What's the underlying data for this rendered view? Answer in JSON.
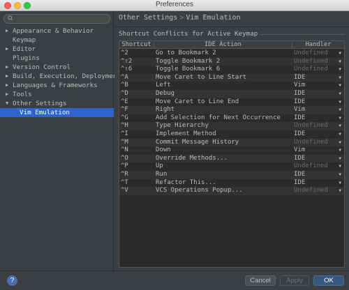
{
  "window": {
    "title": "Preferences"
  },
  "search": {
    "placeholder": ""
  },
  "sidebar": {
    "items": [
      {
        "label": "Appearance & Behavior",
        "arrow": "▶",
        "expanded": false
      },
      {
        "label": "Keymap",
        "arrow": ""
      },
      {
        "label": "Editor",
        "arrow": "▶"
      },
      {
        "label": "Plugins",
        "arrow": ""
      },
      {
        "label": "Version Control",
        "arrow": "▶"
      },
      {
        "label": "Build, Execution, Deployment",
        "arrow": "▶"
      },
      {
        "label": "Languages & Frameworks",
        "arrow": "▶"
      },
      {
        "label": "Tools",
        "arrow": "▶"
      },
      {
        "label": "Other Settings",
        "arrow": "▼"
      },
      {
        "label": "Vim Emulation",
        "arrow": "",
        "child": true,
        "selected": true
      }
    ]
  },
  "breadcrumb": {
    "parent": "Other Settings",
    "separator": ">",
    "current": "Vim Emulation"
  },
  "section": {
    "title": "Shortcut Conflicts for Active Keymap"
  },
  "table": {
    "headers": {
      "shortcut": "Shortcut",
      "action": "IDE Action",
      "handler": "Handler"
    },
    "rows": [
      {
        "shortcut": "^2",
        "action": "Go to Bookmark 2",
        "handler": "Undefined"
      },
      {
        "shortcut": "^⇧2",
        "action": "Toggle Bookmark 2",
        "handler": "Undefined"
      },
      {
        "shortcut": "^⇧6",
        "action": "Toggle Bookmark 6",
        "handler": "Undefined"
      },
      {
        "shortcut": "^A",
        "action": "Move Caret to Line Start",
        "handler": "IDE"
      },
      {
        "shortcut": "^B",
        "action": "Left",
        "handler": "Vim"
      },
      {
        "shortcut": "^D",
        "action": "Debug",
        "handler": "IDE"
      },
      {
        "shortcut": "^E",
        "action": "Move Caret to Line End",
        "handler": "IDE"
      },
      {
        "shortcut": "^F",
        "action": "Right",
        "handler": "Vim"
      },
      {
        "shortcut": "^G",
        "action": "Add Selection for Next Occurrence",
        "handler": "IDE"
      },
      {
        "shortcut": "^H",
        "action": "Type Hierarchy",
        "handler": "Undefined"
      },
      {
        "shortcut": "^I",
        "action": "Implement Method",
        "handler": "IDE"
      },
      {
        "shortcut": "^M",
        "action": "Commit Message History",
        "handler": "Undefined"
      },
      {
        "shortcut": "^N",
        "action": "Down",
        "handler": "Vim"
      },
      {
        "shortcut": "^O",
        "action": "Override Methods...",
        "handler": "IDE"
      },
      {
        "shortcut": "^P",
        "action": "Up",
        "handler": "Undefined"
      },
      {
        "shortcut": "^R",
        "action": "Run",
        "handler": "IDE"
      },
      {
        "shortcut": "^T",
        "action": "Refactor This...",
        "handler": "IDE"
      },
      {
        "shortcut": "^V",
        "action": "VCS Operations Popup...",
        "handler": "Undefined"
      }
    ]
  },
  "buttons": {
    "help": "?",
    "cancel": "Cancel",
    "apply": "Apply",
    "ok": "OK"
  },
  "colors": {
    "selection": "#2f65ca",
    "ok_button": "#365880",
    "undefined_text": "#6b6b6b"
  },
  "icons": {
    "search": "search-icon",
    "dropdown": "chevron-down-icon",
    "help": "help-icon"
  }
}
